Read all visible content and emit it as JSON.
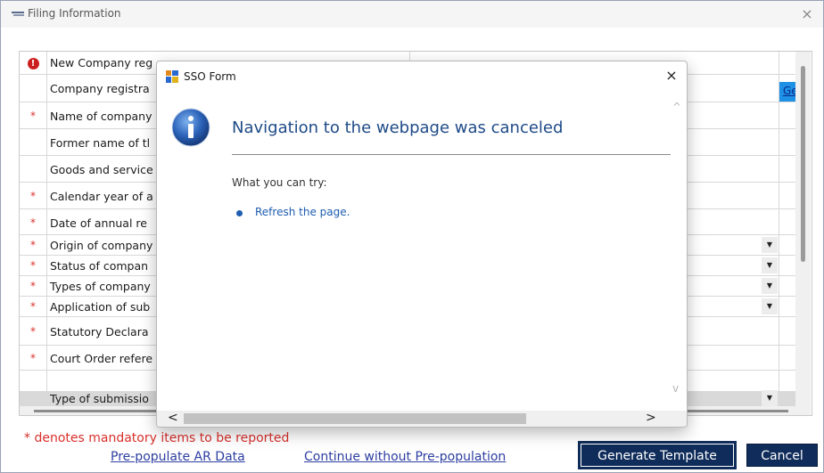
{
  "window": {
    "title": "Filing Information",
    "close": "×"
  },
  "rows": [
    {
      "mark": "alert",
      "label": "New Company reg",
      "shaded": false
    },
    {
      "mark": "",
      "label": "Company registra",
      "shaded": false
    },
    {
      "mark": "*",
      "label": "Name of company",
      "shaded": false
    },
    {
      "mark": "",
      "label": "Former name of tl",
      "shaded": false
    },
    {
      "mark": "",
      "label": "Goods and service",
      "shaded": false
    },
    {
      "mark": "*",
      "label": "Calendar year of a",
      "shaded": false
    },
    {
      "mark": "*",
      "label": "Date of annual re",
      "shaded": false
    },
    {
      "mark": "*",
      "label": "Origin of company",
      "shaded": false
    },
    {
      "mark": "*",
      "label": "Status of compan",
      "shaded": false
    },
    {
      "mark": "*",
      "label": "Types of company",
      "shaded": false
    },
    {
      "mark": "*",
      "label": "Application of sub",
      "shaded": false
    },
    {
      "mark": "*",
      "label": "Statutory Declara",
      "shaded": false
    },
    {
      "mark": "*",
      "label": "Court Order refere",
      "shaded": false
    },
    {
      "mark": "",
      "label": "Type of submissio",
      "shaded": true
    }
  ],
  "get_link": "Get",
  "dropdown_glyph": "▼",
  "footer": {
    "mandatory_note": "* denotes mandatory items to be reported",
    "prepopulate_link": "Pre-populate AR Data",
    "continue_link": "Continue without Pre-population",
    "generate_button": "Generate Template",
    "cancel_button": "Cancel"
  },
  "modal": {
    "title": "SSO Form",
    "close": "×",
    "heading": "Navigation to the webpage was canceled",
    "try_label": "What you can try:",
    "refresh_link": "Refresh the page.",
    "scroll_left": "<",
    "scroll_right": ">",
    "scroll_up": "^",
    "scroll_down": "v"
  },
  "colors": {
    "accent_button": "#0f2c5a",
    "mandatory_red": "#d9302c",
    "link_blue": "#2c3ea0",
    "modal_heading": "#1e4a87"
  }
}
